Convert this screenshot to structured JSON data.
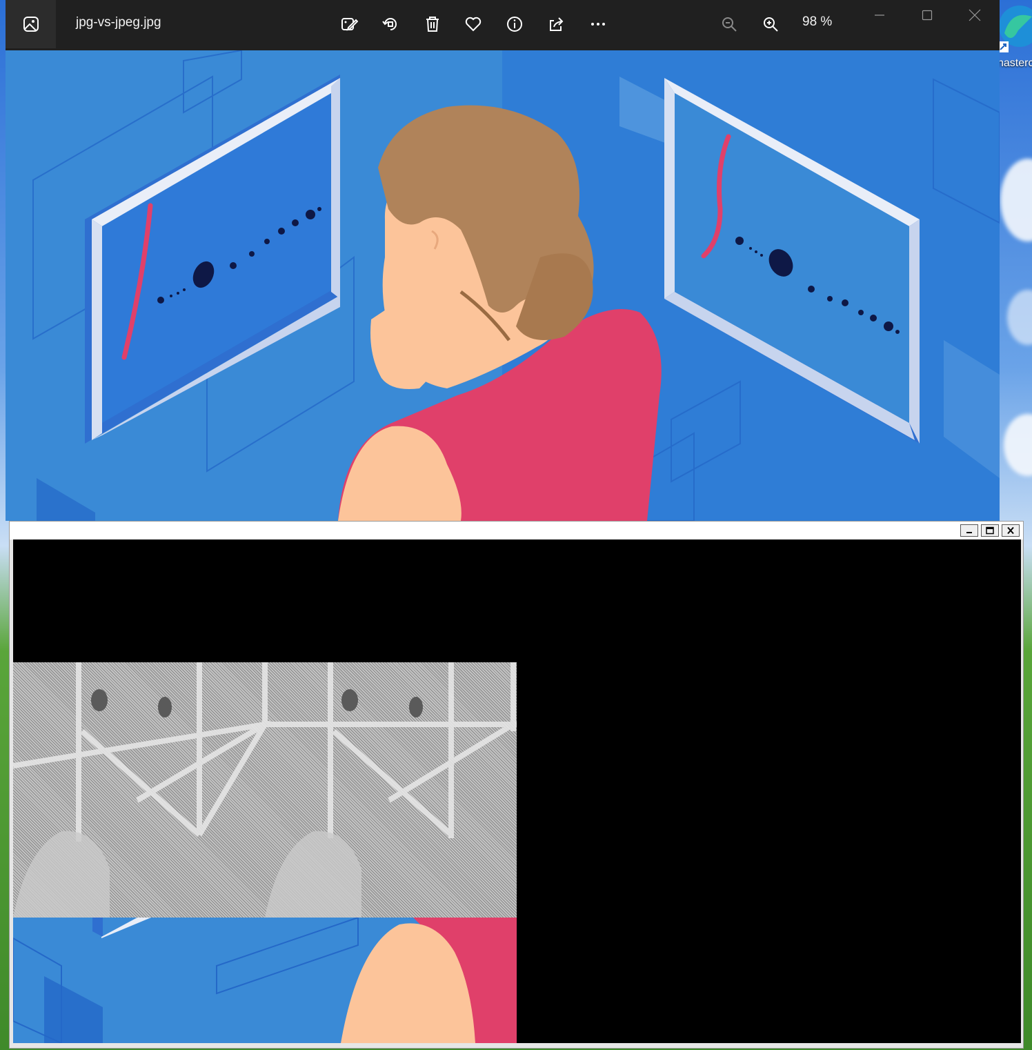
{
  "photos_window": {
    "filename": "jpg-vs-jpeg.jpg",
    "zoom_label": "98 %",
    "toolbar": [
      "edit-image-icon",
      "rotate-icon",
      "delete-icon",
      "favorite-icon",
      "info-icon",
      "share-icon",
      "more-icon"
    ]
  },
  "desktop": {
    "icon_label": "nasterc"
  },
  "colors": {
    "titlebar": "#202020",
    "scene_blue": "#3a8ad6",
    "shirt": "#e0406a",
    "hair": "#b0835a",
    "skin": "#fcc49a"
  }
}
